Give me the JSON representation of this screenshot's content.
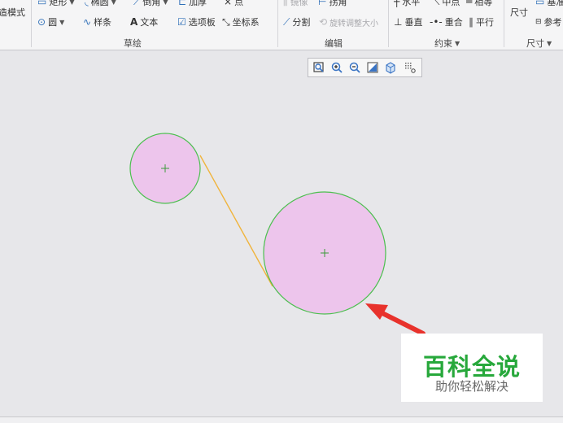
{
  "ribbon": {
    "sketch_mode": {
      "label": "造模式"
    },
    "row1": {
      "rect": "矩形",
      "ellipse": "椭圆",
      "fillet": "倒角",
      "thicken": "加厚",
      "point": "点",
      "mirror": "镜像",
      "trim": "拐角",
      "horizontal": "水平",
      "midpoint": "中点",
      "equal": "相等",
      "baseline": "基准"
    },
    "row2": {
      "circle": "圆",
      "spline": "样条",
      "text": "文本",
      "palette": "选项板",
      "coordsys": "坐标系",
      "divide": "分割",
      "rotate_resize": "旋转调整大小",
      "vertical": "垂直",
      "coincident": "重合",
      "parallel": "平行",
      "reference": "参考"
    },
    "dimension": {
      "label": "尺寸"
    },
    "groups": {
      "sketch": "草绘",
      "edit": "编辑",
      "constrain": "约束",
      "dimension": "尺寸"
    }
  },
  "view_toolbar": {
    "icons": [
      "refit-icon",
      "zoom-in-icon",
      "zoom-out-icon",
      "repaint-icon",
      "display-style-icon",
      "sketch-display-icon"
    ]
  },
  "drawing": {
    "fill_color": "#edc5ec",
    "outline_color": "#4cbf4f",
    "line_color": "#f0b43c",
    "center_mark_color": "#3a9a3a"
  },
  "annotation": {
    "arrow_color": "#e8322c"
  },
  "watermark": {
    "title": "百科全说",
    "subtitle": "助你轻松解决",
    "title_color": "#27a83b"
  }
}
